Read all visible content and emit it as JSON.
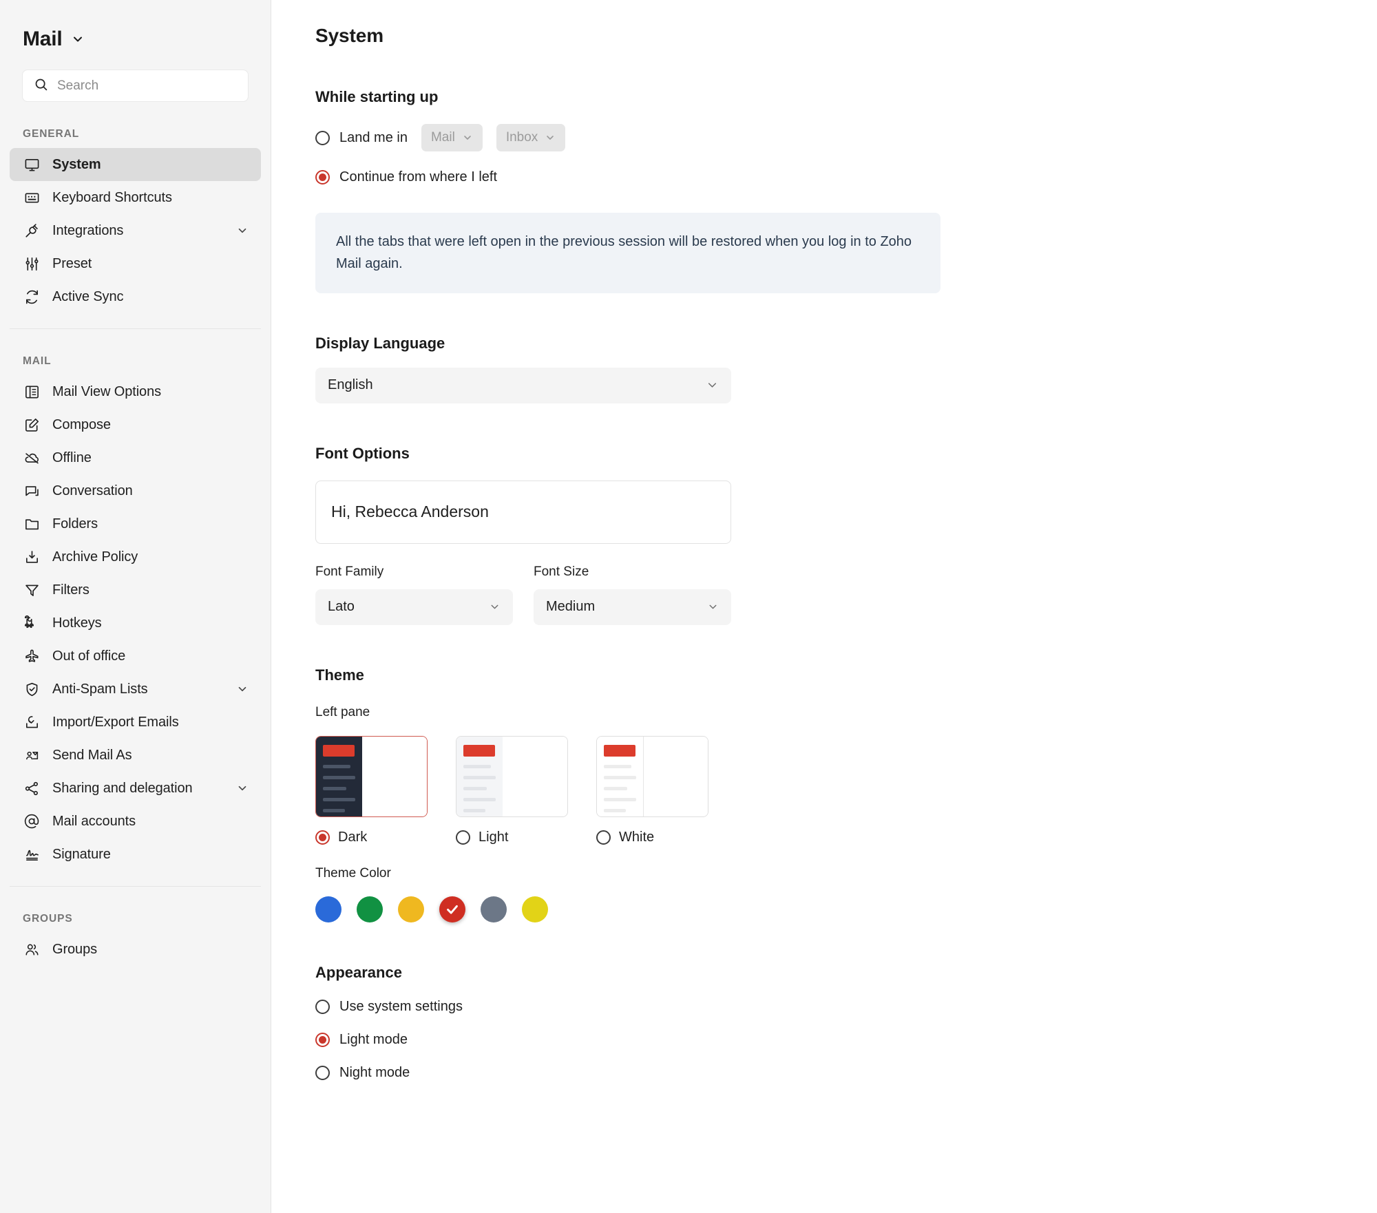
{
  "sidebar": {
    "brand": {
      "title": "Mail",
      "chevron_icon": "chevron-down-icon"
    },
    "search": {
      "placeholder": "Search",
      "value": "",
      "icon": "search-icon"
    },
    "sections": [
      {
        "label": "GENERAL",
        "items": [
          {
            "label": "System",
            "icon": "monitor-icon",
            "active": true,
            "expandable": false
          },
          {
            "label": "Keyboard Shortcuts",
            "icon": "keyboard-icon",
            "active": false,
            "expandable": false
          },
          {
            "label": "Integrations",
            "icon": "plug-icon",
            "active": false,
            "expandable": true
          },
          {
            "label": "Preset",
            "icon": "sliders-icon",
            "active": false,
            "expandable": false
          },
          {
            "label": "Active Sync",
            "icon": "refresh-icon",
            "active": false,
            "expandable": false
          }
        ]
      },
      {
        "label": "MAIL",
        "items": [
          {
            "label": "Mail View Options",
            "icon": "layout-icon",
            "active": false,
            "expandable": false
          },
          {
            "label": "Compose",
            "icon": "pencil-square-icon",
            "active": false,
            "expandable": false
          },
          {
            "label": "Offline",
            "icon": "cloud-off-icon",
            "active": false,
            "expandable": false
          },
          {
            "label": "Conversation",
            "icon": "chat-bubble-icon",
            "active": false,
            "expandable": false
          },
          {
            "label": "Folders",
            "icon": "folder-icon",
            "active": false,
            "expandable": false
          },
          {
            "label": "Archive Policy",
            "icon": "archive-icon",
            "active": false,
            "expandable": false
          },
          {
            "label": "Filters",
            "icon": "funnel-icon",
            "active": false,
            "expandable": false
          },
          {
            "label": "Hotkeys",
            "icon": "command-icon",
            "active": false,
            "expandable": false
          },
          {
            "label": "Out of office",
            "icon": "airplane-icon",
            "active": false,
            "expandable": false
          },
          {
            "label": "Anti-Spam Lists",
            "icon": "shield-check-icon",
            "active": false,
            "expandable": true
          },
          {
            "label": "Import/Export Emails",
            "icon": "import-export-icon",
            "active": false,
            "expandable": false
          },
          {
            "label": "Send Mail As",
            "icon": "user-card-icon",
            "active": false,
            "expandable": false
          },
          {
            "label": "Sharing and delegation",
            "icon": "share-nodes-icon",
            "active": false,
            "expandable": true
          },
          {
            "label": "Mail accounts",
            "icon": "at-sign-icon",
            "active": false,
            "expandable": false
          },
          {
            "label": "Signature",
            "icon": "signature-icon",
            "active": false,
            "expandable": false
          }
        ]
      },
      {
        "label": "GROUPS",
        "items": [
          {
            "label": "Groups",
            "icon": "users-icon",
            "active": false,
            "expandable": false
          }
        ]
      }
    ]
  },
  "main": {
    "page_title": "System",
    "startup": {
      "heading": "While starting up",
      "option_land": {
        "label": "Land me in",
        "selected": false
      },
      "land_app_dropdown": {
        "value": "Mail",
        "icon": "chevron-down-icon"
      },
      "land_folder_dropdown": {
        "value": "Inbox",
        "icon": "chevron-down-icon"
      },
      "option_continue": {
        "label": "Continue from where I left",
        "selected": true
      },
      "info_banner": "All the tabs that were left open in the previous session will be restored when you log in to Zoho Mail again."
    },
    "display_language": {
      "heading": "Display Language",
      "value": "English",
      "icon": "chevron-down-icon"
    },
    "font_options": {
      "heading": "Font Options",
      "preview_text": "Hi, Rebecca Anderson",
      "font_family": {
        "label": "Font Family",
        "value": "Lato",
        "icon": "chevron-down-icon"
      },
      "font_size": {
        "label": "Font Size",
        "value": "Medium",
        "icon": "chevron-down-icon"
      }
    },
    "theme": {
      "heading": "Theme",
      "left_pane_label": "Left pane",
      "options": [
        {
          "label": "Dark",
          "variant": "dark",
          "selected": true
        },
        {
          "label": "Light",
          "variant": "light",
          "selected": false
        },
        {
          "label": "White",
          "variant": "white",
          "selected": false
        }
      ],
      "theme_color_label": "Theme Color",
      "colors": [
        {
          "name": "blue",
          "hex": "#2a6ad9",
          "selected": false
        },
        {
          "name": "green",
          "hex": "#119142",
          "selected": false
        },
        {
          "name": "amber",
          "hex": "#efb820",
          "selected": false
        },
        {
          "name": "red",
          "hex": "#cf2e22",
          "selected": true
        },
        {
          "name": "slate-gray",
          "hex": "#6c7787",
          "selected": false
        },
        {
          "name": "yellow",
          "hex": "#e2d317",
          "selected": false
        }
      ],
      "check_icon": "check-icon"
    },
    "appearance": {
      "heading": "Appearance",
      "options": [
        {
          "label": "Use system settings",
          "selected": false
        },
        {
          "label": "Light mode",
          "selected": true
        },
        {
          "label": "Night mode",
          "selected": false
        }
      ]
    },
    "accent_color": "#c9372c"
  }
}
